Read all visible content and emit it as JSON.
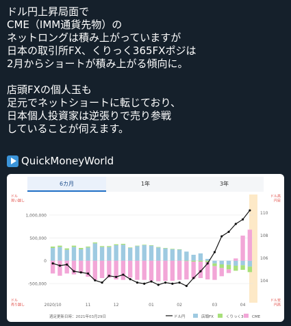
{
  "tweet": {
    "paragraph1": "ドル円上昇局面で\nCME（IMM通貨先物）の\nネットロングは積み上がっていますが\n日本の取引所FX、くりっく365FXポジは\n2月からショートが積み上がる傾向に。",
    "paragraph2": "店頭FXの個人玉も\n足元でネットショートに転じており、\n日本個人投資家は逆張りで売り参戦\nしていることが伺えます。",
    "link": "QuickMoneyWorld"
  },
  "chart_tabs": [
    "6カ月",
    "1年",
    "3年"
  ],
  "active_tab": 0,
  "axis_side_labels": {
    "left_top": "ドル\n買い越し",
    "right_top": "ドル高\n円安",
    "left_bottom": "ドル\n売り越し",
    "right_bottom": "ドル安\n円高"
  },
  "footnote": "週足更新日時：2021年03月29日",
  "legend": [
    "ドル円",
    "店頭FX",
    "くりっく365",
    "CME"
  ],
  "colors": {
    "usdjpy": "#111111",
    "otc_fx": "#9ecae1",
    "click365": "#a8e07a",
    "cme": "#f2a6d7",
    "highlight": "#fde9c7",
    "tab_active": "#1f6fc5"
  },
  "chart_data": {
    "type": "bar",
    "x_ticks": [
      "2020/10",
      "11",
      "12",
      "01",
      "02",
      "03",
      "04"
    ],
    "left_axis": {
      "ticks": [
        "1,000,000",
        "500,000",
        "0",
        "-500,000"
      ],
      "ylim": [
        -800000,
        1300000
      ]
    },
    "right_axis": {
      "ticks": [
        "110",
        "108",
        "106",
        "104"
      ],
      "ylim": [
        102.5,
        111
      ]
    },
    "series": [
      {
        "name": "店頭FX",
        "values": [
          280000,
          300000,
          240000,
          300000,
          250000,
          290000,
          380000,
          300000,
          300000,
          340000,
          350000,
          280000,
          320000,
          340000,
          330000,
          290000,
          270000,
          250000,
          250000,
          200000,
          130000,
          160000,
          40000,
          -60000,
          -80000,
          -90000,
          -110000,
          -100000,
          -130000
        ]
      },
      {
        "name": "くりっく365",
        "values": [
          30000,
          30000,
          30000,
          30000,
          30000,
          20000,
          20000,
          20000,
          20000,
          20000,
          20000,
          10000,
          10000,
          10000,
          10000,
          10000,
          10000,
          10000,
          0,
          -10000,
          -20000,
          -20000,
          -30000,
          -60000,
          -80000,
          -100000,
          -110000,
          -100000,
          -120000
        ]
      },
      {
        "name": "CME",
        "values": [
          -280000,
          -330000,
          -280000,
          -300000,
          -270000,
          -350000,
          -420000,
          -380000,
          -370000,
          -410000,
          -420000,
          -370000,
          -420000,
          -420000,
          -440000,
          -450000,
          -440000,
          -440000,
          -420000,
          -400000,
          -370000,
          -360000,
          -380000,
          -300000,
          -180000,
          -80000,
          50000,
          550000,
          680000
        ]
      },
      {
        "name": "ドル円",
        "values": [
          105.5,
          105.3,
          105.4,
          104.8,
          104.7,
          104.6,
          104.0,
          103.8,
          104.4,
          104.3,
          104.5,
          104.1,
          103.8,
          103.7,
          103.9,
          103.6,
          103.8,
          103.7,
          103.8,
          103.5,
          104.2,
          104.8,
          105.5,
          106.5,
          107.9,
          108.3,
          109.0,
          109.4,
          110.2
        ]
      }
    ]
  }
}
